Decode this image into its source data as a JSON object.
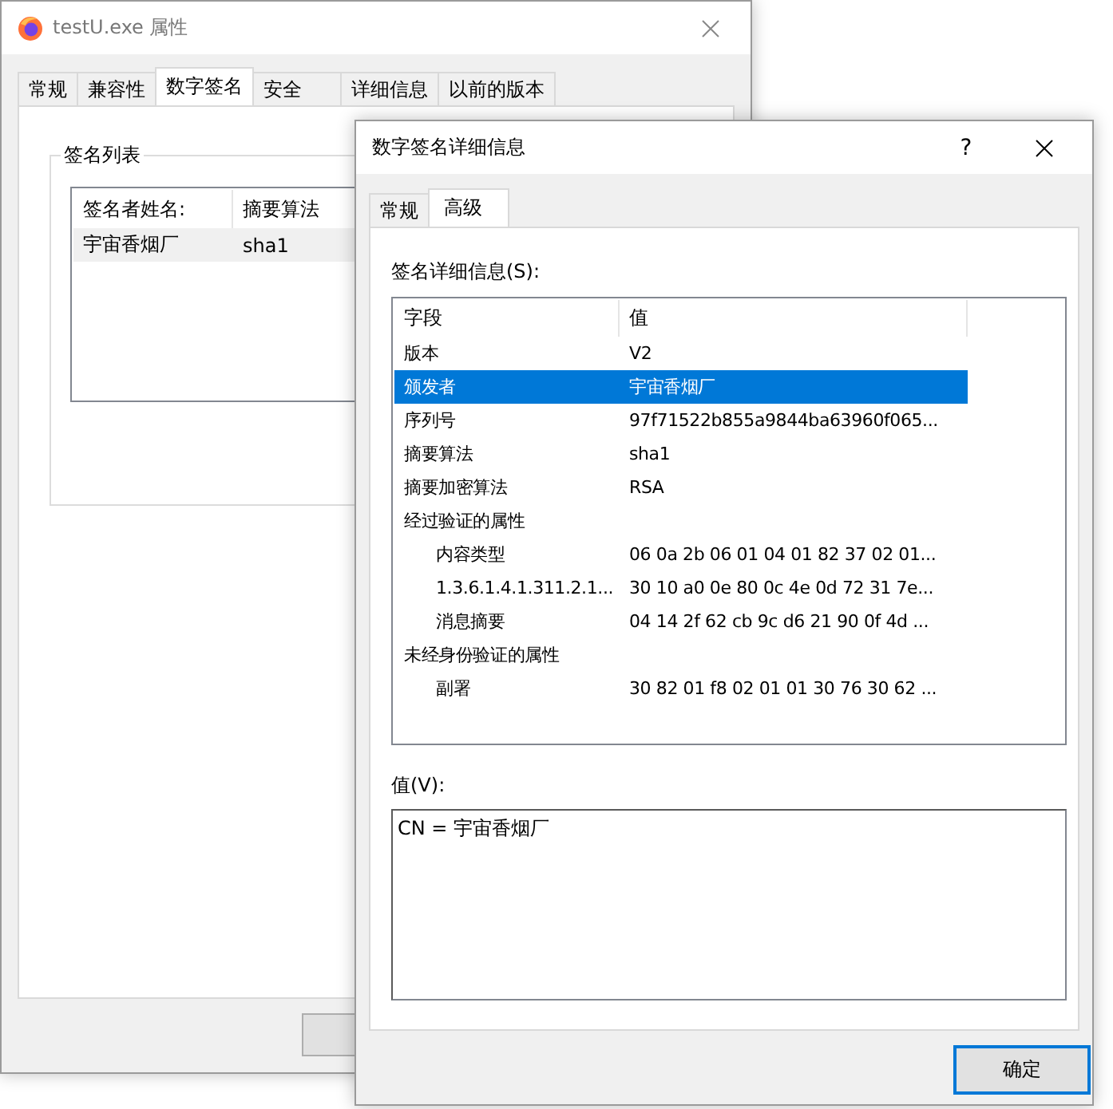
{
  "back_window": {
    "title": "testU.exe 属性",
    "tabs": [
      {
        "label": "常规",
        "selected": false
      },
      {
        "label": "兼容性",
        "selected": false
      },
      {
        "label": "数字签名",
        "selected": true
      },
      {
        "label": "安全",
        "selected": false
      },
      {
        "label": "详细信息",
        "selected": false
      },
      {
        "label": "以前的版本",
        "selected": false
      }
    ],
    "group_title": "签名列表",
    "list": {
      "columns": [
        "签名者姓名:",
        "摘要算法"
      ],
      "rows": [
        {
          "cells": [
            "宇宙香烟厂",
            "sha1"
          ],
          "selected": true
        }
      ]
    }
  },
  "dialog": {
    "title": "数字签名详细信息",
    "help": "?",
    "tabs": [
      {
        "label": "常规",
        "selected": false
      },
      {
        "label": "高级",
        "selected": true
      }
    ],
    "details_label": "签名详细信息(S):",
    "columns": [
      "字段",
      "值"
    ],
    "rows": [
      {
        "field": "版本",
        "value": "V2",
        "selected": false
      },
      {
        "field": "颁发者",
        "value": "宇宙香烟厂",
        "selected": true
      },
      {
        "field": "序列号",
        "value": "97f71522b855a9844ba63960f065...",
        "selected": false
      },
      {
        "field": "摘要算法",
        "value": "sha1",
        "selected": false
      },
      {
        "field": "摘要加密算法",
        "value": "RSA",
        "selected": false
      },
      {
        "field": "经过验证的属性",
        "selected": false,
        "children": [
          {
            "field": "内容类型",
            "value": "06 0a 2b 06 01 04 01 82 37 02 01...",
            "selected": false
          },
          {
            "field": "1.3.6.1.4.1.311.2.1...",
            "value": "30 10 a0 0e 80 0c 4e 0d 72 31 7e...",
            "selected": false
          },
          {
            "field": "消息摘要",
            "value": "04 14 2f 62 cb 9c d6 21 90 0f 4d ...",
            "selected": false
          }
        ]
      },
      {
        "field": "未经身份验证的属性",
        "selected": false,
        "children": [
          {
            "field": "副署",
            "value": "30 82 01 f8 02 01 01 30 76 30 62 ...",
            "selected": false
          }
        ]
      }
    ],
    "value_label": "值(V):",
    "value_text": "CN = 宇宙香烟厂",
    "ok_button": "确定"
  }
}
